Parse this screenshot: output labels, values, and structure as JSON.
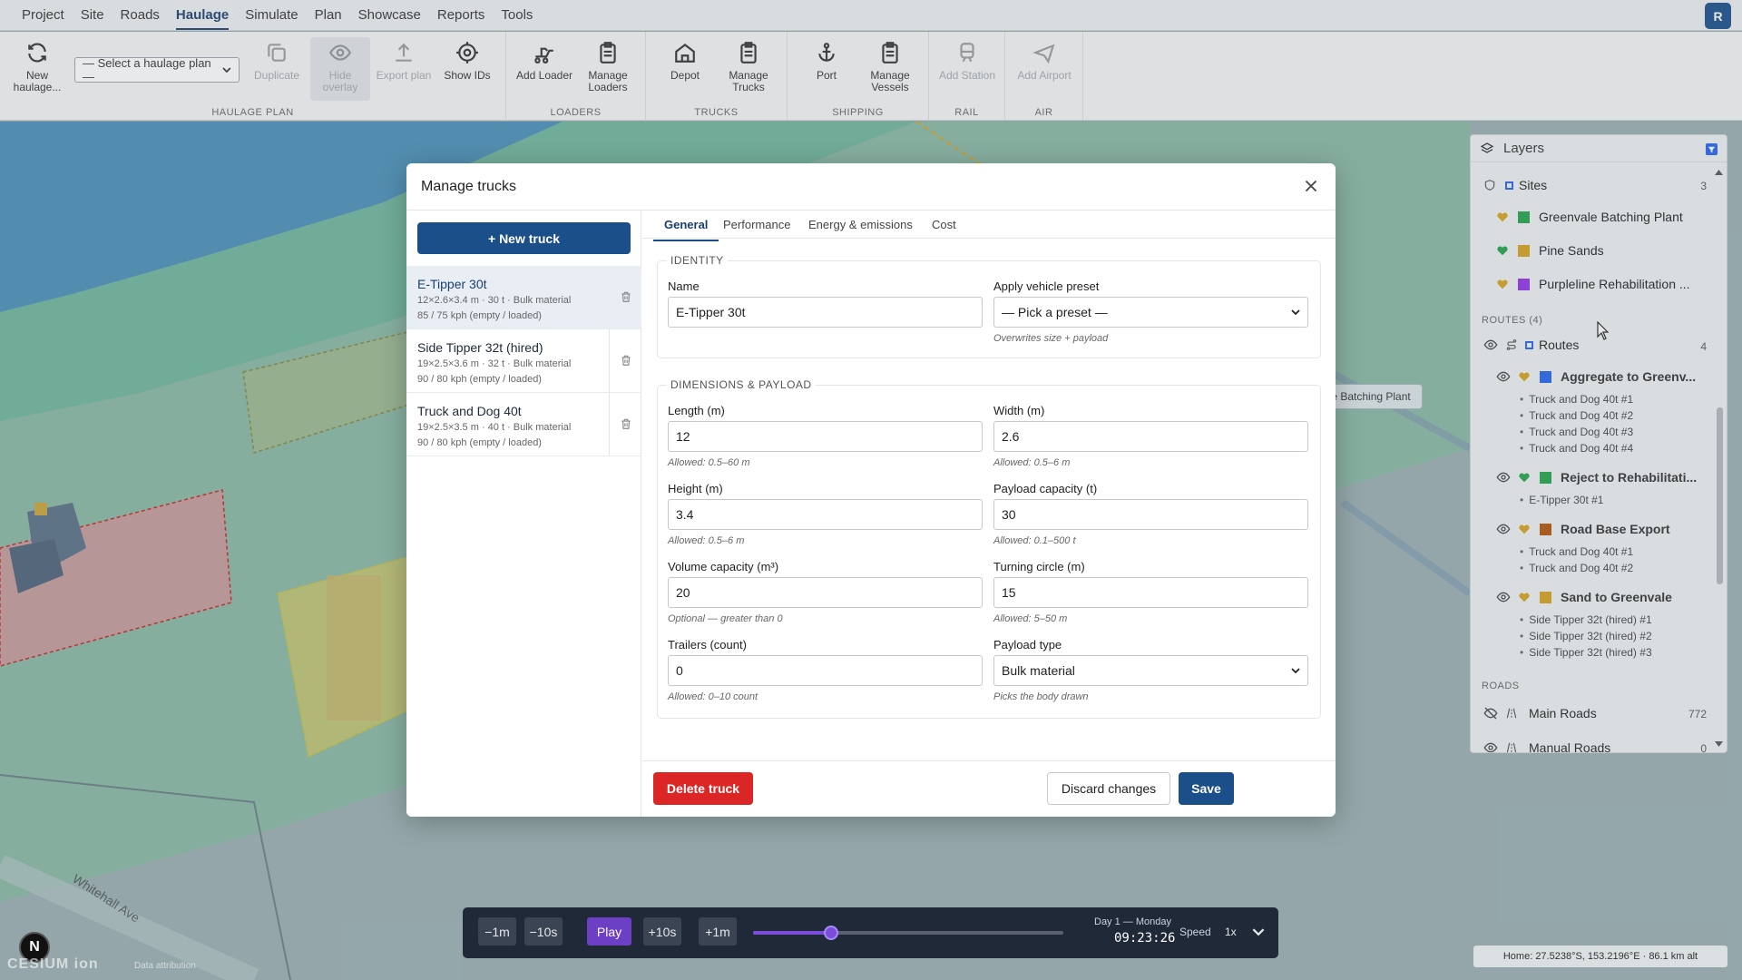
{
  "menu": {
    "items": [
      "Project",
      "Site",
      "Roads",
      "Haulage",
      "Simulate",
      "Plan",
      "Showcase",
      "Reports",
      "Tools"
    ],
    "active": "Haulage",
    "avatar": "R"
  },
  "ribbon": {
    "new_haulage": "New haulage...",
    "plan_select": "— Select a haulage plan —",
    "duplicate": "Duplicate",
    "hide_overlay": "Hide overlay",
    "export_plan": "Export plan",
    "show_ids": "Show IDs",
    "add_loader": "Add Loader",
    "manage_loaders": "Manage Loaders",
    "depot": "Depot",
    "manage_trucks": "Manage Trucks",
    "port": "Port",
    "manage_vessels": "Manage Vessels",
    "add_station": "Add Station",
    "add_airport": "Add Airport",
    "groups": {
      "haulage_plan": "HAULAGE PLAN",
      "loaders": "LOADERS",
      "trucks": "TRUCKS",
      "shipping": "SHIPPING",
      "rail": "RAIL",
      "air": "AIR"
    }
  },
  "layers": {
    "title": "Layers",
    "sites_label": "Sites",
    "sites_count": "3",
    "sites": [
      {
        "name": "Greenvale Batching Plant",
        "color": "#22a34a"
      },
      {
        "name": "Pine Sands",
        "color": "#d6a21e"
      },
      {
        "name": "Purpleline Rehabilitation ...",
        "color": "#9333ea"
      }
    ],
    "routes_section": "ROUTES (4)",
    "routes_label": "Routes",
    "routes_count": "4",
    "routes": [
      {
        "name": "Aggregate to Greenv...",
        "color": "#2563eb",
        "trucks": [
          "Truck and Dog 40t #1",
          "Truck and Dog 40t #2",
          "Truck and Dog 40t #3",
          "Truck and Dog 40t #4"
        ]
      },
      {
        "name": "Reject to Rehabilitati...",
        "color": "#22a34a",
        "trucks": [
          "E-Tipper 30t #1"
        ]
      },
      {
        "name": "Road Base Export",
        "color": "#b45309",
        "trucks": [
          "Truck and Dog 40t #1",
          "Truck and Dog 40t #2"
        ]
      },
      {
        "name": "Sand to Greenvale",
        "color": "#d6a21e",
        "trucks": [
          "Side Tipper 32t (hired) #1",
          "Side Tipper 32t (hired) #2",
          "Side Tipper 32t (hired) #3"
        ]
      }
    ],
    "roads_section": "ROADS",
    "roads": [
      {
        "name": "Main Roads",
        "count": "772"
      },
      {
        "name": "Manual Roads",
        "count": "0"
      }
    ]
  },
  "map": {
    "site_label": "ale Batching Plant",
    "road_label": "Whitehall Ave"
  },
  "modal": {
    "title": "Manage trucks",
    "new_truck": "+ New truck",
    "trucks": [
      {
        "name": "E-Tipper 30t",
        "meta1": "12×2.6×3.4 m · 30 t · Bulk material",
        "meta2": "85 / 75 kph (empty / loaded)"
      },
      {
        "name": "Side Tipper 32t (hired)",
        "meta1": "19×2.5×3.6 m · 32 t · Bulk material",
        "meta2": "90 / 80 kph (empty / loaded)"
      },
      {
        "name": "Truck and Dog 40t",
        "meta1": "19×2.5×3.5 m · 40 t · Bulk material",
        "meta2": "90 / 80 kph (empty / loaded)"
      }
    ],
    "tabs": [
      "General",
      "Performance",
      "Energy & emissions",
      "Cost"
    ],
    "identity": {
      "legend": "IDENTITY",
      "name_label": "Name",
      "name_value": "E-Tipper 30t",
      "preset_label": "Apply vehicle preset",
      "preset_value": "— Pick a preset —",
      "preset_hint": "Overwrites size + payload"
    },
    "dims": {
      "legend": "DIMENSIONS & PAYLOAD",
      "length_label": "Length (m)",
      "length_value": "12",
      "length_hint": "Allowed: 0.5–60 m",
      "width_label": "Width (m)",
      "width_value": "2.6",
      "width_hint": "Allowed: 0.5–6 m",
      "height_label": "Height (m)",
      "height_value": "3.4",
      "height_hint": "Allowed: 0.5–6 m",
      "payload_label": "Payload capacity (t)",
      "payload_value": "30",
      "payload_hint": "Allowed: 0.1–500 t",
      "volume_label": "Volume capacity (m³)",
      "volume_value": "20",
      "volume_hint": "Optional — greater than 0",
      "turning_label": "Turning circle (m)",
      "turning_value": "15",
      "turning_hint": "Allowed: 5–50 m",
      "trailers_label": "Trailers (count)",
      "trailers_value": "0",
      "trailers_hint": "Allowed: 0–10 count",
      "ptype_label": "Payload type",
      "ptype_value": "Bulk material",
      "ptype_hint": "Picks the body drawn"
    },
    "delete": "Delete truck",
    "discard": "Discard changes",
    "save": "Save"
  },
  "timeline": {
    "minus1m": "−1m",
    "minus10s": "−10s",
    "play": "Play",
    "plus10s": "+10s",
    "plus1m": "+1m",
    "progress": 0.25,
    "day": "Day 1 — Monday",
    "time": "09:23:26",
    "speed_label": "Speed",
    "speed_value": "1x"
  },
  "compass": "N",
  "cesium": "CESIUM ion",
  "cesium_attr": "Data attribution",
  "coords": "Home: 27.5238°S, 153.2196°E · 86.1 km alt"
}
